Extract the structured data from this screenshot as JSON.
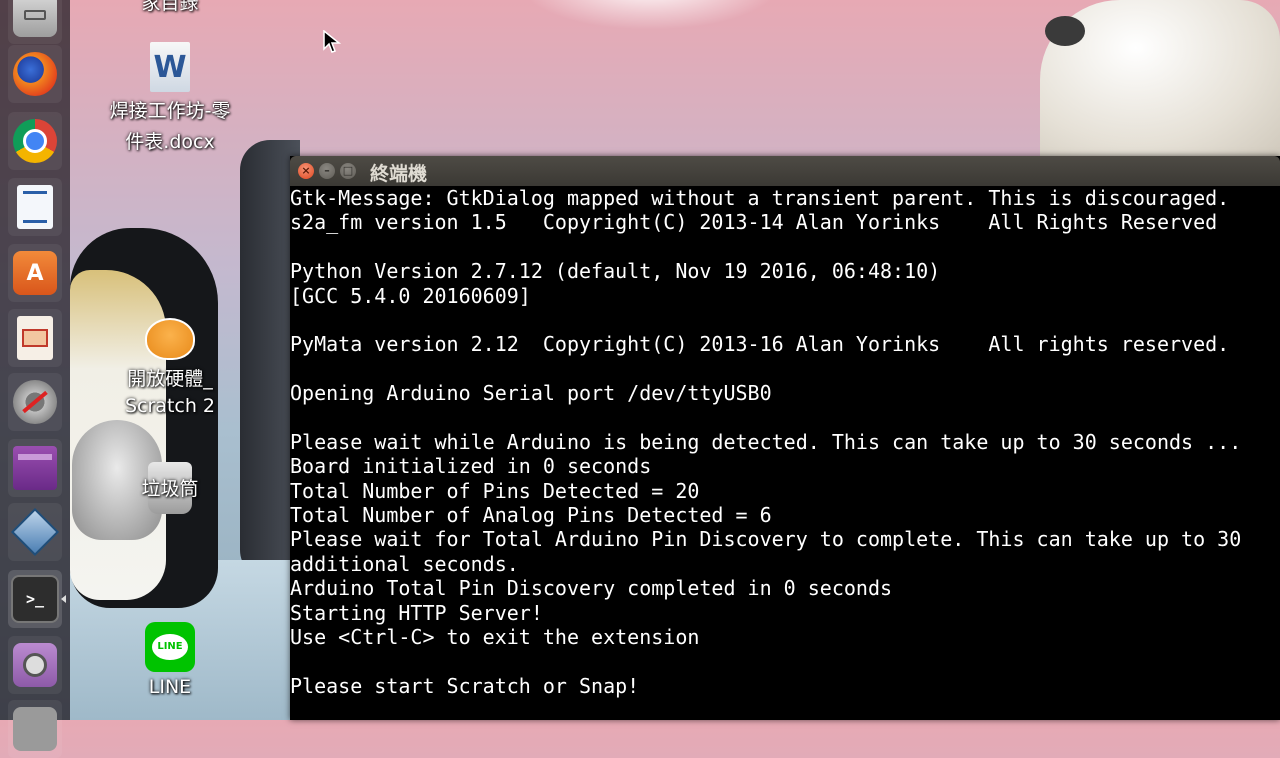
{
  "desktop": {
    "icons": [
      {
        "label": "家目錄",
        "icon": "home-folder-icon"
      },
      {
        "label": "焊接工作坊-零件表.docx",
        "line1": "焊接工作坊-零",
        "line2": "件表.docx",
        "icon": "word-document-icon",
        "badge": "W"
      },
      {
        "label": "開放硬體_Scratch 2",
        "line1": "開放硬體_",
        "line2": "Scratch 2",
        "icon": "scratch-cat-icon"
      },
      {
        "label": "垃圾筒",
        "icon": "trash-icon"
      },
      {
        "label": "LINE",
        "icon": "line-app-icon",
        "badge": "LINE"
      }
    ]
  },
  "launcher": {
    "items": [
      {
        "name": "files",
        "icon": "file-cabinet-icon"
      },
      {
        "name": "firefox",
        "icon": "firefox-icon"
      },
      {
        "name": "chrome",
        "icon": "chrome-icon"
      },
      {
        "name": "writer",
        "icon": "libreoffice-writer-icon"
      },
      {
        "name": "software-center",
        "icon": "software-center-icon",
        "glyph": "A"
      },
      {
        "name": "impress",
        "icon": "libreoffice-impress-icon"
      },
      {
        "name": "settings",
        "icon": "system-settings-icon"
      },
      {
        "name": "workspaces",
        "icon": "workspace-switcher-icon"
      },
      {
        "name": "virtualbox",
        "icon": "virtualbox-icon"
      },
      {
        "name": "terminal",
        "icon": "terminal-icon",
        "glyph": ">_"
      },
      {
        "name": "webcam",
        "icon": "webcam-icon"
      },
      {
        "name": "trash",
        "icon": "launcher-trash-icon"
      }
    ]
  },
  "terminal": {
    "title": "終端機",
    "buttons": {
      "close": "×",
      "minimize": "–",
      "maximize": "□"
    },
    "lines": [
      "Gtk-Message: GtkDialog mapped without a transient parent. This is discouraged.",
      "s2a_fm version 1.5   Copyright(C) 2013-14 Alan Yorinks    All Rights Reserved",
      "",
      "Python Version 2.7.12 (default, Nov 19 2016, 06:48:10)",
      "[GCC 5.4.0 20160609]",
      "",
      "PyMata version 2.12  Copyright(C) 2013-16 Alan Yorinks    All rights reserved.",
      "",
      "Opening Arduino Serial port /dev/ttyUSB0",
      "",
      "Please wait while Arduino is being detected. This can take up to 30 seconds ...",
      "Board initialized in 0 seconds",
      "Total Number of Pins Detected = 20",
      "Total Number of Analog Pins Detected = 6",
      "Please wait for Total Arduino Pin Discovery to complete. This can take up to 30",
      "additional seconds.",
      "Arduino Total Pin Discovery completed in 0 seconds",
      "Starting HTTP Server!",
      "Use <Ctrl-C> to exit the extension",
      "",
      "Please start Scratch or Snap!"
    ]
  },
  "colors": {
    "terminal_bg": "#000000",
    "terminal_fg": "#ffffff",
    "titlebar": "#3b3934",
    "close_button": "#e0461f"
  }
}
